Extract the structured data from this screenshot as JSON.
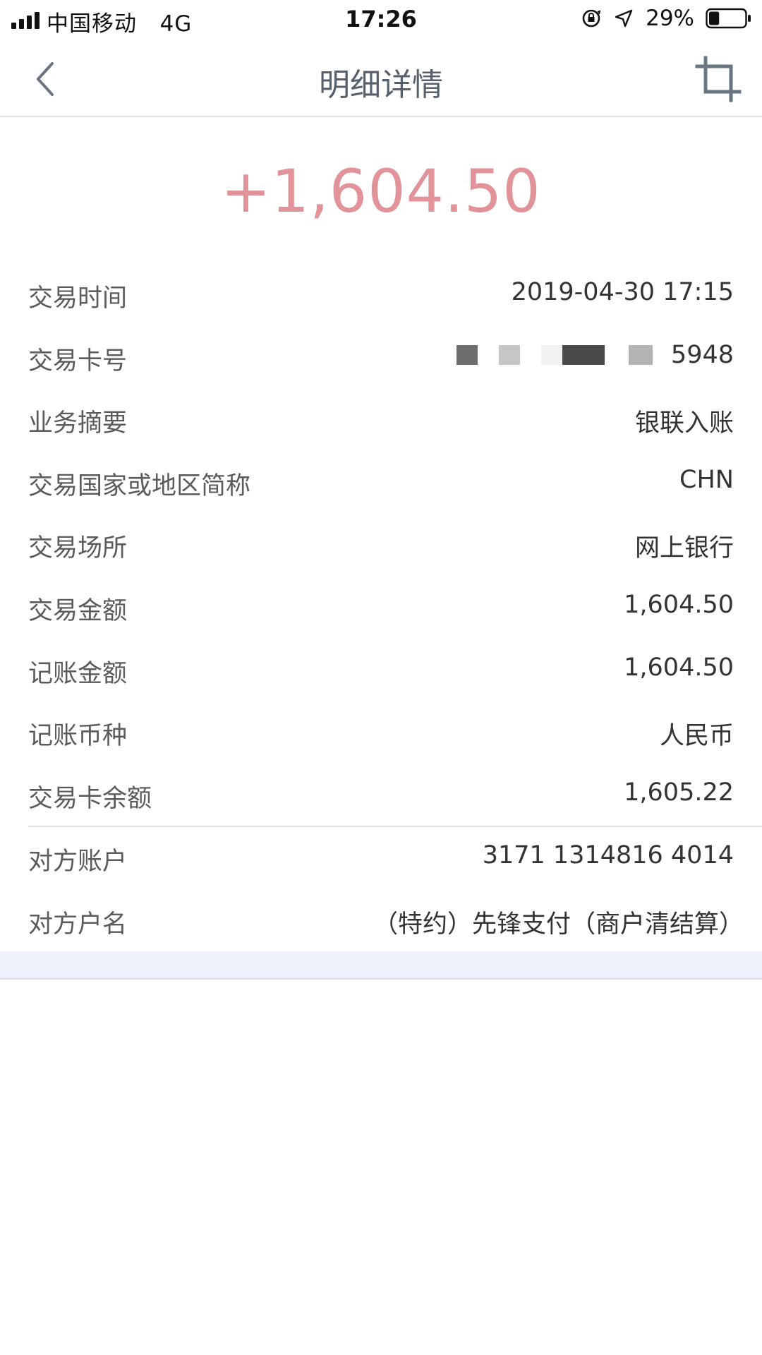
{
  "status_bar": {
    "carrier": "中国移动",
    "network": "4G",
    "time": "17:26",
    "battery": "29%",
    "battery_level": 0.29
  },
  "nav": {
    "title": "明细详情",
    "back_icon": "chevron-left-icon",
    "crop_icon": "crop-icon"
  },
  "amount": "+1,604.50",
  "colors": {
    "amount": "#e2939a",
    "title": "#56606c",
    "label": "#5b5b5b",
    "value": "#333333"
  },
  "details": [
    {
      "label": "交易时间",
      "value": "2019-04-30 17:15"
    },
    {
      "label": "交易卡号",
      "value": "5948"
    },
    {
      "label": "业务摘要",
      "value": "银联入账"
    },
    {
      "label": "交易国家或地区简称",
      "value": "CHN"
    },
    {
      "label": "交易场所",
      "value": "网上银行"
    },
    {
      "label": "交易金额",
      "value": "1,604.50"
    },
    {
      "label": "记账金额",
      "value": "1,604.50"
    },
    {
      "label": "记账币种",
      "value": "人民币"
    },
    {
      "label": "交易卡余额",
      "value": "1,605.22"
    }
  ],
  "counterparty": [
    {
      "label": "对方账户",
      "value": "3171 1314816 4014"
    },
    {
      "label": "对方户名",
      "value": "（特约）先锋支付（商户清结算）"
    }
  ]
}
